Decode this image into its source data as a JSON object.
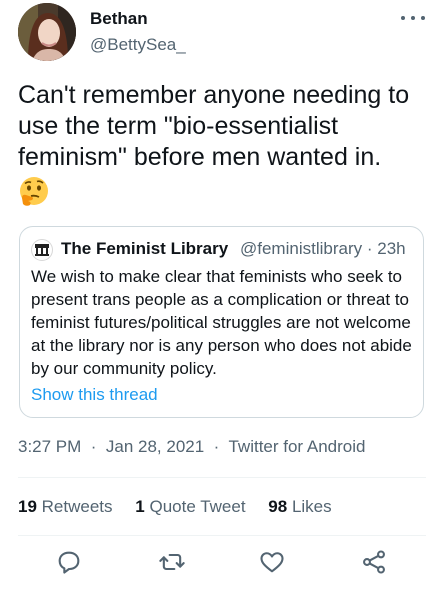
{
  "author": {
    "display_name": "Bethan",
    "handle": "@BettySea_"
  },
  "tweet": {
    "text": "Can't remember anyone needing to use the term \"bio-essentialist feminism\" before men wanted in.",
    "emoji": "thinking-face"
  },
  "quoted_tweet": {
    "display_name": "The Feminist Library",
    "handle": "@feministlibrary",
    "separator": "·",
    "time": "23h",
    "text": "We wish to make clear that feminists who seek to present trans people as a complication or threat to feminist futures/political struggles are not welcome at the library nor is any person who does not abide by our community policy.",
    "thread_link": "Show this thread"
  },
  "meta": {
    "time": "3:27 PM",
    "date": "Jan 28, 2021",
    "source": "Twitter for Android"
  },
  "stats": {
    "retweets_count": "19",
    "retweets_label": "Retweets",
    "quotes_count": "1",
    "quotes_label": "Quote Tweet",
    "likes_count": "98",
    "likes_label": "Likes"
  },
  "actions": [
    "reply-icon",
    "retweet-icon",
    "like-icon",
    "share-icon"
  ],
  "colors": {
    "text": "#0f1419",
    "secondary": "#536471",
    "link": "#1d9bf0",
    "border": "#cfd9de"
  }
}
